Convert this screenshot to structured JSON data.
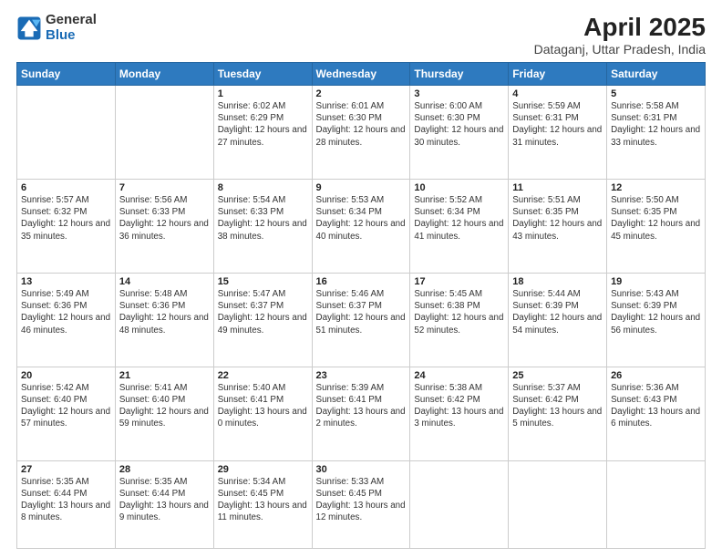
{
  "header": {
    "logo_general": "General",
    "logo_blue": "Blue",
    "title": "April 2025",
    "subtitle": "Dataganj, Uttar Pradesh, India"
  },
  "days_of_week": [
    "Sunday",
    "Monday",
    "Tuesday",
    "Wednesday",
    "Thursday",
    "Friday",
    "Saturday"
  ],
  "weeks": [
    [
      {
        "day": "",
        "info": ""
      },
      {
        "day": "",
        "info": ""
      },
      {
        "day": "1",
        "info": "Sunrise: 6:02 AM\nSunset: 6:29 PM\nDaylight: 12 hours and 27 minutes."
      },
      {
        "day": "2",
        "info": "Sunrise: 6:01 AM\nSunset: 6:30 PM\nDaylight: 12 hours and 28 minutes."
      },
      {
        "day": "3",
        "info": "Sunrise: 6:00 AM\nSunset: 6:30 PM\nDaylight: 12 hours and 30 minutes."
      },
      {
        "day": "4",
        "info": "Sunrise: 5:59 AM\nSunset: 6:31 PM\nDaylight: 12 hours and 31 minutes."
      },
      {
        "day": "5",
        "info": "Sunrise: 5:58 AM\nSunset: 6:31 PM\nDaylight: 12 hours and 33 minutes."
      }
    ],
    [
      {
        "day": "6",
        "info": "Sunrise: 5:57 AM\nSunset: 6:32 PM\nDaylight: 12 hours and 35 minutes."
      },
      {
        "day": "7",
        "info": "Sunrise: 5:56 AM\nSunset: 6:33 PM\nDaylight: 12 hours and 36 minutes."
      },
      {
        "day": "8",
        "info": "Sunrise: 5:54 AM\nSunset: 6:33 PM\nDaylight: 12 hours and 38 minutes."
      },
      {
        "day": "9",
        "info": "Sunrise: 5:53 AM\nSunset: 6:34 PM\nDaylight: 12 hours and 40 minutes."
      },
      {
        "day": "10",
        "info": "Sunrise: 5:52 AM\nSunset: 6:34 PM\nDaylight: 12 hours and 41 minutes."
      },
      {
        "day": "11",
        "info": "Sunrise: 5:51 AM\nSunset: 6:35 PM\nDaylight: 12 hours and 43 minutes."
      },
      {
        "day": "12",
        "info": "Sunrise: 5:50 AM\nSunset: 6:35 PM\nDaylight: 12 hours and 45 minutes."
      }
    ],
    [
      {
        "day": "13",
        "info": "Sunrise: 5:49 AM\nSunset: 6:36 PM\nDaylight: 12 hours and 46 minutes."
      },
      {
        "day": "14",
        "info": "Sunrise: 5:48 AM\nSunset: 6:36 PM\nDaylight: 12 hours and 48 minutes."
      },
      {
        "day": "15",
        "info": "Sunrise: 5:47 AM\nSunset: 6:37 PM\nDaylight: 12 hours and 49 minutes."
      },
      {
        "day": "16",
        "info": "Sunrise: 5:46 AM\nSunset: 6:37 PM\nDaylight: 12 hours and 51 minutes."
      },
      {
        "day": "17",
        "info": "Sunrise: 5:45 AM\nSunset: 6:38 PM\nDaylight: 12 hours and 52 minutes."
      },
      {
        "day": "18",
        "info": "Sunrise: 5:44 AM\nSunset: 6:39 PM\nDaylight: 12 hours and 54 minutes."
      },
      {
        "day": "19",
        "info": "Sunrise: 5:43 AM\nSunset: 6:39 PM\nDaylight: 12 hours and 56 minutes."
      }
    ],
    [
      {
        "day": "20",
        "info": "Sunrise: 5:42 AM\nSunset: 6:40 PM\nDaylight: 12 hours and 57 minutes."
      },
      {
        "day": "21",
        "info": "Sunrise: 5:41 AM\nSunset: 6:40 PM\nDaylight: 12 hours and 59 minutes."
      },
      {
        "day": "22",
        "info": "Sunrise: 5:40 AM\nSunset: 6:41 PM\nDaylight: 13 hours and 0 minutes."
      },
      {
        "day": "23",
        "info": "Sunrise: 5:39 AM\nSunset: 6:41 PM\nDaylight: 13 hours and 2 minutes."
      },
      {
        "day": "24",
        "info": "Sunrise: 5:38 AM\nSunset: 6:42 PM\nDaylight: 13 hours and 3 minutes."
      },
      {
        "day": "25",
        "info": "Sunrise: 5:37 AM\nSunset: 6:42 PM\nDaylight: 13 hours and 5 minutes."
      },
      {
        "day": "26",
        "info": "Sunrise: 5:36 AM\nSunset: 6:43 PM\nDaylight: 13 hours and 6 minutes."
      }
    ],
    [
      {
        "day": "27",
        "info": "Sunrise: 5:35 AM\nSunset: 6:44 PM\nDaylight: 13 hours and 8 minutes."
      },
      {
        "day": "28",
        "info": "Sunrise: 5:35 AM\nSunset: 6:44 PM\nDaylight: 13 hours and 9 minutes."
      },
      {
        "day": "29",
        "info": "Sunrise: 5:34 AM\nSunset: 6:45 PM\nDaylight: 13 hours and 11 minutes."
      },
      {
        "day": "30",
        "info": "Sunrise: 5:33 AM\nSunset: 6:45 PM\nDaylight: 13 hours and 12 minutes."
      },
      {
        "day": "",
        "info": ""
      },
      {
        "day": "",
        "info": ""
      },
      {
        "day": "",
        "info": ""
      }
    ]
  ]
}
